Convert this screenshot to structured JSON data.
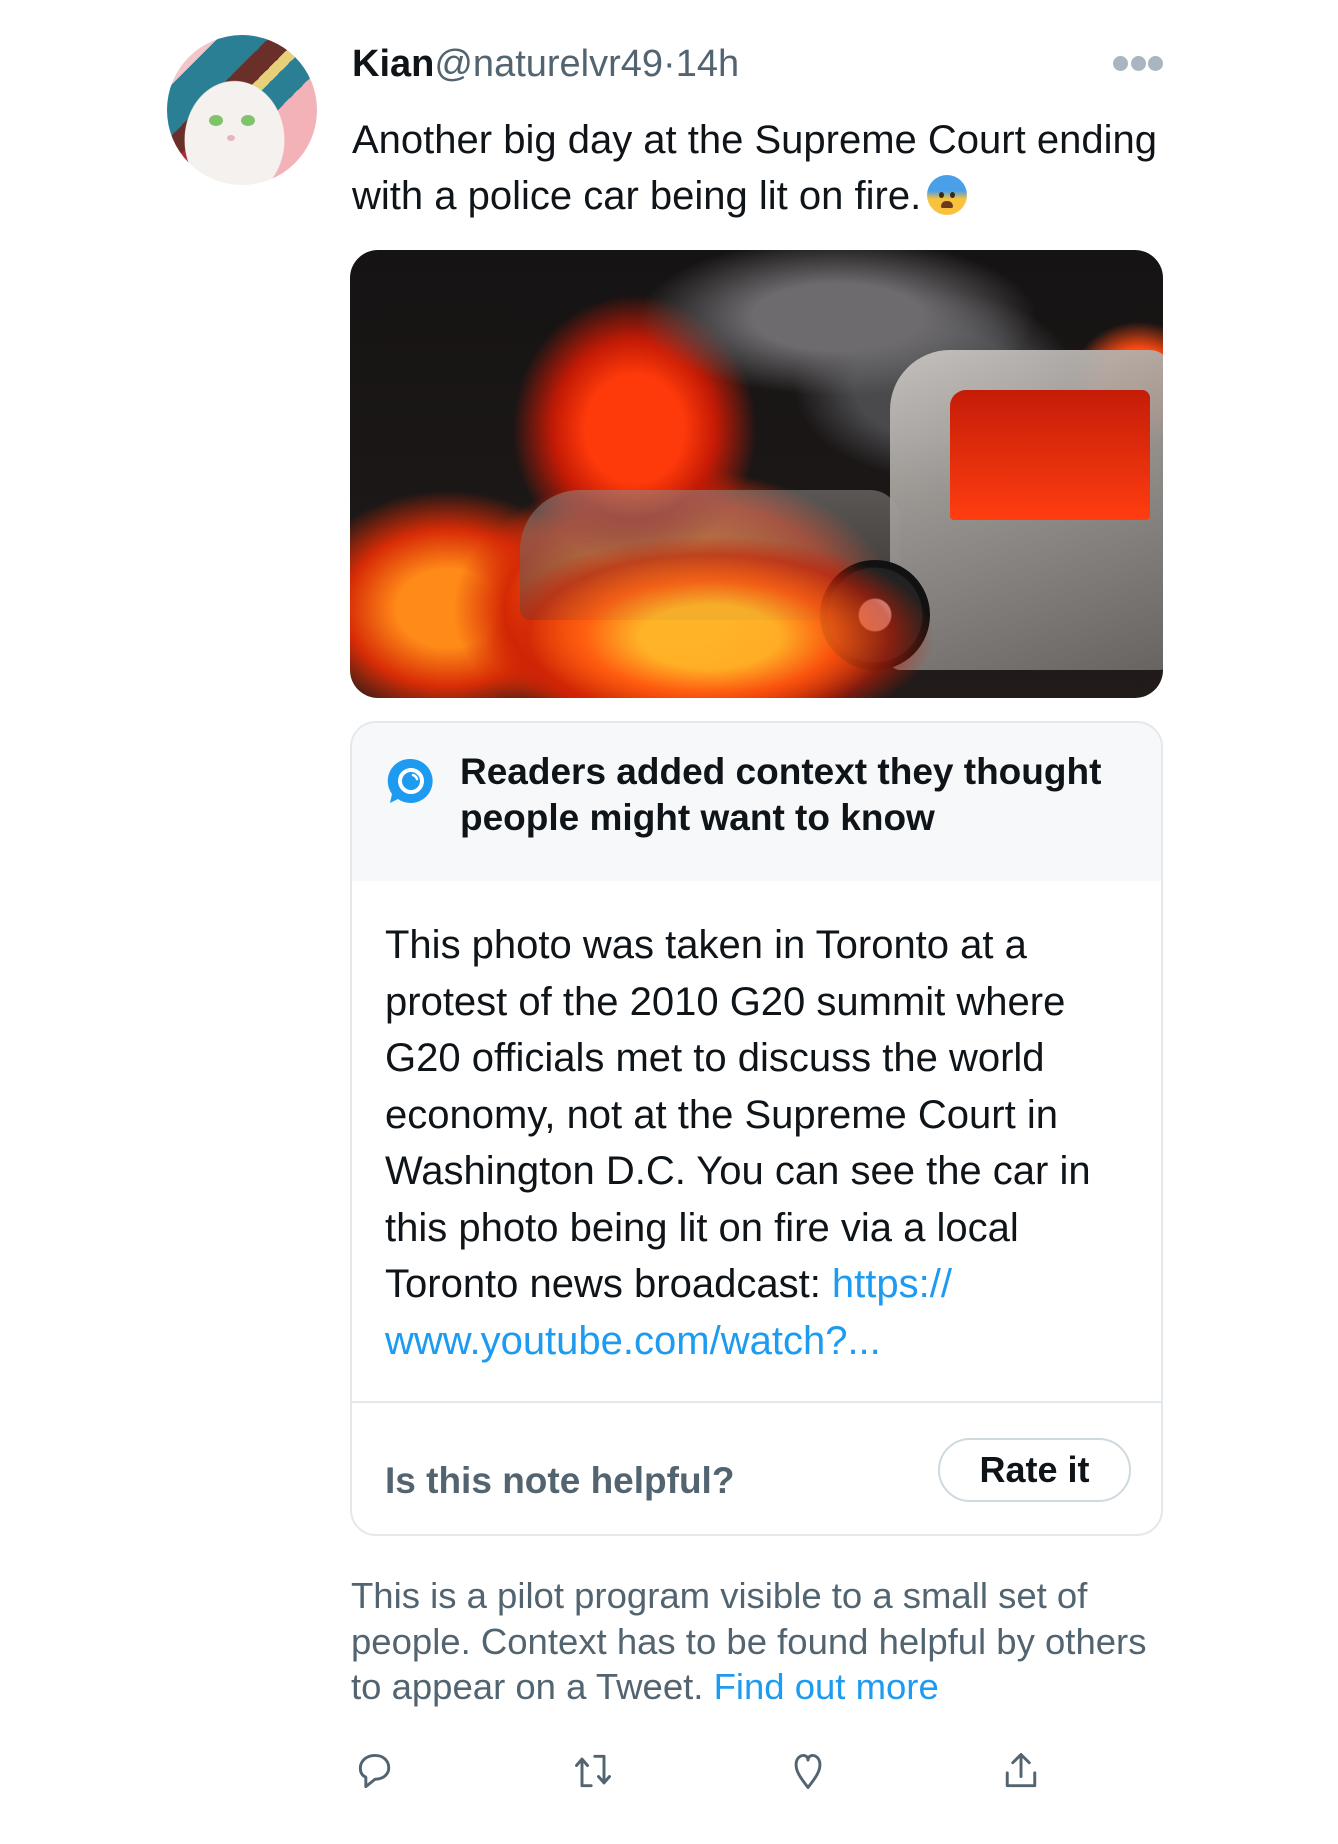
{
  "tweet": {
    "author": {
      "name": "Kian",
      "handle": "@naturelvr49",
      "separator": "·",
      "time": "14h",
      "avatar": "white-cat-painting-avatar"
    },
    "more_icon": "more-horizontal-icon",
    "text": "Another big day at the Supreme Court ending with a police car being lit on fire.",
    "emoji": "fearful-face-emoji",
    "media": {
      "description": "Police car engulfed in flames with smoke"
    }
  },
  "note": {
    "icon": "birdwatch-icon",
    "title": "Readers added context they thought people might want to know",
    "body": "This photo was taken in Toronto at a protest of the 2010 G20 summit where G20 officials met to discuss the world economy, not at the Supreme Court in Washington D.C. You can see the car in this photo being lit on fire via a local Toronto news broadcast: ",
    "link_text": "https:// www.youtube.com/watch?...",
    "helpful_prompt": "Is this note helpful?",
    "rate_button": "Rate it"
  },
  "pilot": {
    "text": "This is a pilot program visible to a small set of people. Context has to be found helpful by others to appear on a Tweet. ",
    "link": "Find out more"
  },
  "actions": [
    {
      "name": "reply",
      "icon": "reply-icon"
    },
    {
      "name": "retweet",
      "icon": "retweet-icon"
    },
    {
      "name": "like",
      "icon": "heart-icon"
    },
    {
      "name": "share",
      "icon": "share-icon"
    }
  ],
  "colors": {
    "accent": "#1d9bf0",
    "secondary_text": "#536471",
    "primary_text": "#0f1419",
    "border": "#e3e8ec",
    "note_header_bg": "#f6f8f9"
  }
}
